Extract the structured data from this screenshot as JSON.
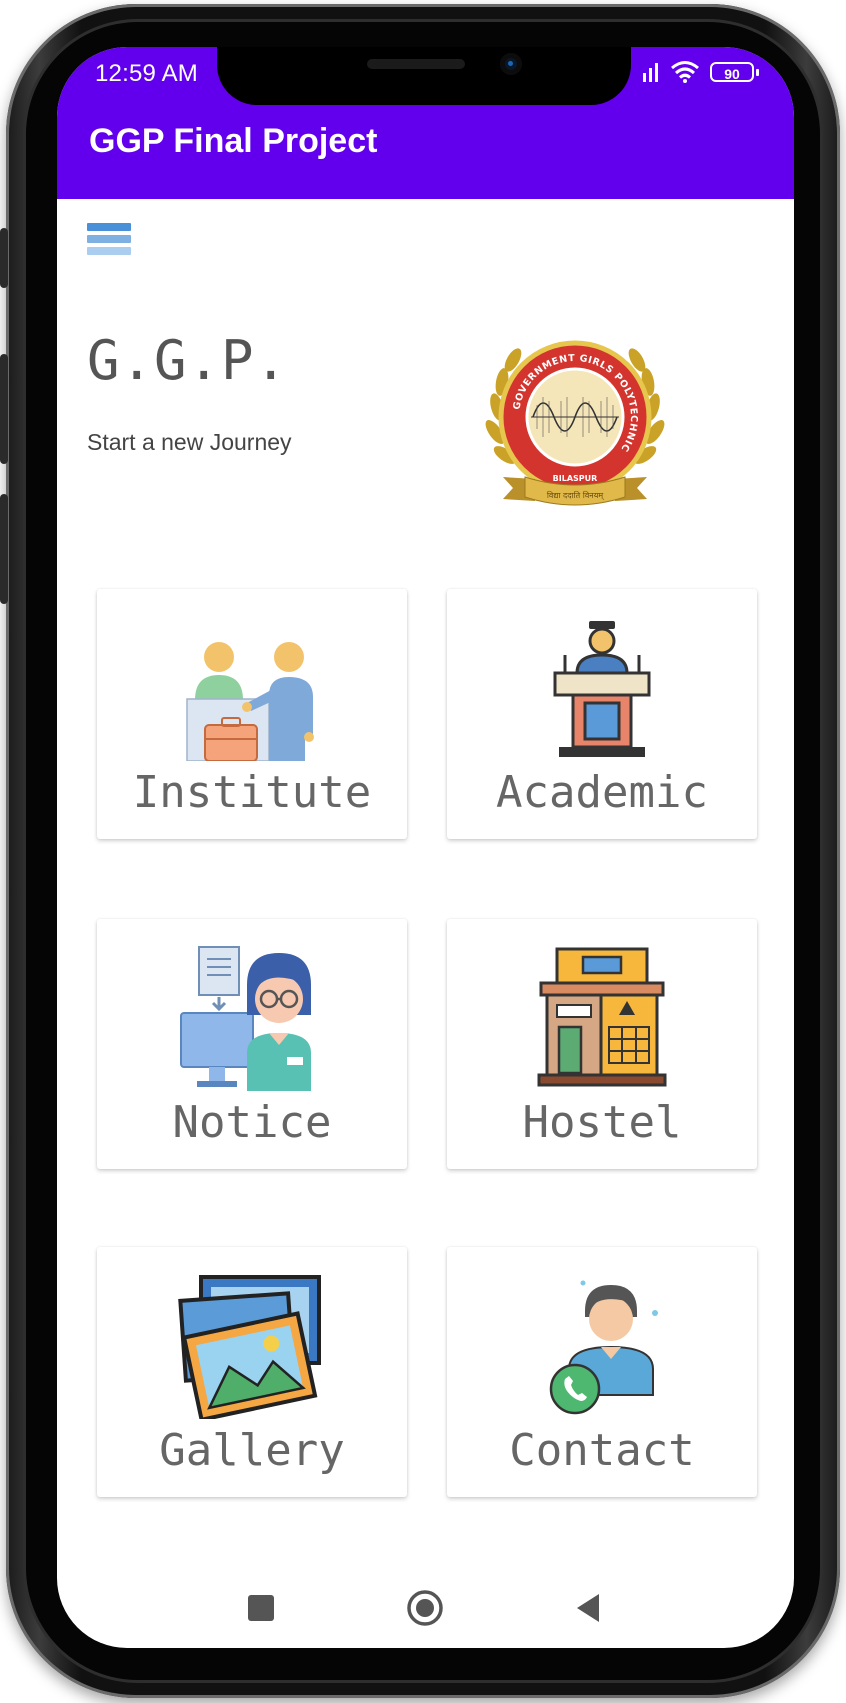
{
  "status_bar": {
    "time": "12:59 AM",
    "battery_level": "90"
  },
  "app_bar": {
    "title": "GGP Final Project",
    "color": "#6200EE"
  },
  "header": {
    "brand": "G.G.P.",
    "tagline": "Start a new Journey"
  },
  "logo": {
    "ring_text": "GOVERNMENT GIRLS POLYTECHNIC",
    "city_text": "BILASPUR",
    "ribbon_text": "विद्या ददाति विनयम्"
  },
  "menu": [
    {
      "label": "Institute",
      "icon": "reception-icon"
    },
    {
      "label": "Academic",
      "icon": "lectern-icon"
    },
    {
      "label": "Notice",
      "icon": "notice-icon"
    },
    {
      "label": "Hostel",
      "icon": "hostel-icon"
    },
    {
      "label": "Gallery",
      "icon": "gallery-icon"
    },
    {
      "label": "Contact",
      "icon": "contact-icon"
    }
  ],
  "nav": {
    "recents": "square-icon",
    "home": "circle-icon",
    "back": "triangle-icon"
  }
}
